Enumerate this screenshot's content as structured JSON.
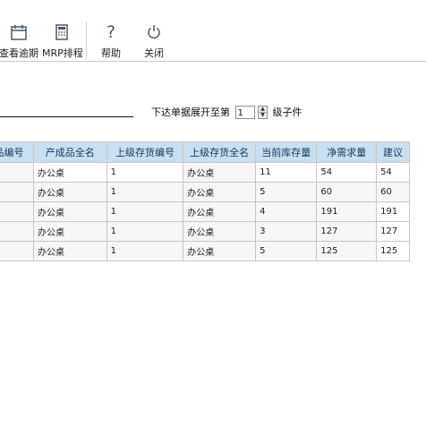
{
  "toolbar": {
    "buttons": [
      {
        "label": "查看逾期",
        "icon": "calendar-icon"
      },
      {
        "label": "MRP排程",
        "icon": "calculator-icon"
      },
      {
        "label": "帮助",
        "icon": "help-icon"
      },
      {
        "label": "关闭",
        "icon": "power-icon"
      }
    ]
  },
  "expand": {
    "prefix": "下达单据展开至第",
    "level_value": "1",
    "suffix": "级子件"
  },
  "table": {
    "columns": [
      "品编号",
      "产成品全名",
      "上级存货编号",
      "上级存货全名",
      "当前库存量",
      "净需求量",
      "建议"
    ],
    "rows": [
      [
        "",
        "办公桌",
        "1",
        "办公桌",
        "11",
        "54",
        "54"
      ],
      [
        "",
        "办公桌",
        "1",
        "办公桌",
        "5",
        "60",
        "60"
      ],
      [
        "",
        "办公桌",
        "1",
        "办公桌",
        "4",
        "191",
        "191"
      ],
      [
        "",
        "办公桌",
        "1",
        "办公桌",
        "3",
        "127",
        "127"
      ],
      [
        "",
        "办公桌",
        "1",
        "办公桌",
        "5",
        "125",
        "125"
      ]
    ]
  }
}
